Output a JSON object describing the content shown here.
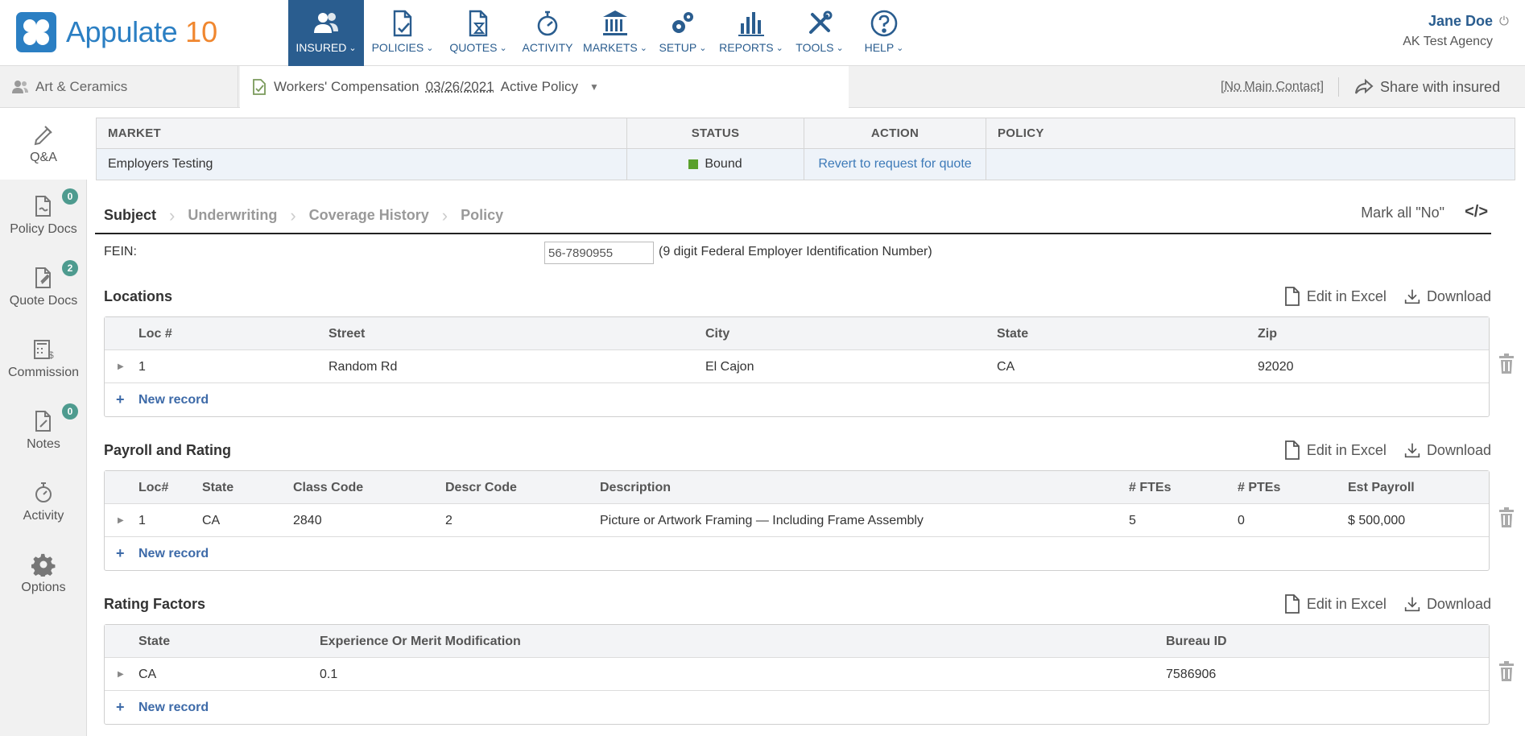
{
  "app": {
    "name": "Appulate",
    "version": "10"
  },
  "nav": [
    {
      "id": "insured",
      "label": "INSURED",
      "active": true,
      "icon": "users-icon"
    },
    {
      "id": "policies",
      "label": "POLICIES",
      "icon": "policy-doc-icon"
    },
    {
      "id": "quotes",
      "label": "QUOTES",
      "icon": "quote-hourglass-icon"
    },
    {
      "id": "activity",
      "label": "ACTIVITY",
      "icon": "stopwatch-icon"
    },
    {
      "id": "markets",
      "label": "MARKETS",
      "icon": "bank-icon"
    },
    {
      "id": "setup",
      "label": "SETUP",
      "icon": "gears-icon"
    },
    {
      "id": "reports",
      "label": "REPORTS",
      "icon": "bar-chart-icon"
    },
    {
      "id": "tools",
      "label": "TOOLS",
      "icon": "tools-icon"
    },
    {
      "id": "help",
      "label": "HELP",
      "icon": "help-icon"
    }
  ],
  "user": {
    "name": "Jane Doe",
    "agency": "AK Test Agency"
  },
  "subbar": {
    "insured": "Art & Ceramics",
    "policy_type": "Workers' Compensation",
    "policy_date": "03/26/2021",
    "policy_status": "Active Policy",
    "contact": "No Main Contact",
    "share": "Share with insured"
  },
  "rail": [
    {
      "label": "Q&A",
      "icon": "pen-icon",
      "active": true
    },
    {
      "label": "Policy Docs",
      "icon": "policy-docs-icon",
      "badge": "0"
    },
    {
      "label": "Quote Docs",
      "icon": "quote-docs-icon",
      "badge": "2"
    },
    {
      "label": "Commission",
      "icon": "calculator-icon"
    },
    {
      "label": "Notes",
      "icon": "notes-icon",
      "badge": "0"
    },
    {
      "label": "Activity",
      "icon": "stopwatch-icon"
    },
    {
      "label": "Options",
      "icon": "gear-icon"
    }
  ],
  "markets_table": {
    "headers": [
      "MARKET",
      "STATUS",
      "ACTION",
      "POLICY"
    ],
    "row": {
      "market": "Employers Testing",
      "status": "Bound",
      "status_color": "#5aa02c",
      "action": "Revert to request for quote",
      "policy": ""
    }
  },
  "steps": [
    "Subject",
    "Underwriting",
    "Coverage History",
    "Policy"
  ],
  "mark_all": "Mark all \"No\"",
  "fein": {
    "label": "FEIN:",
    "value": "56-7890955",
    "hint": "(9 digit Federal Employer Identification Number)"
  },
  "actions": {
    "edit": "Edit in Excel",
    "download": "Download",
    "new_record": "New record"
  },
  "locations": {
    "title": "Locations",
    "headers": [
      "Loc #",
      "Street",
      "City",
      "State",
      "Zip"
    ],
    "rows": [
      [
        "1",
        "Random Rd",
        "El Cajon",
        "CA",
        "92020"
      ]
    ]
  },
  "payroll": {
    "title": "Payroll and Rating",
    "headers": [
      "Loc#",
      "State",
      "Class Code",
      "Descr Code",
      "Description",
      "# FTEs",
      "# PTEs",
      "Est Payroll"
    ],
    "rows": [
      [
        "1",
        "CA",
        "2840",
        "2",
        "Picture or Artwork Framing — Including Frame Assembly",
        "5",
        "0",
        "$ 500,000"
      ]
    ]
  },
  "rating": {
    "title": "Rating Factors",
    "headers": [
      "State",
      "Experience Or Merit Modification",
      "Bureau ID"
    ],
    "rows": [
      [
        "CA",
        "0.1",
        "7586906"
      ]
    ]
  }
}
